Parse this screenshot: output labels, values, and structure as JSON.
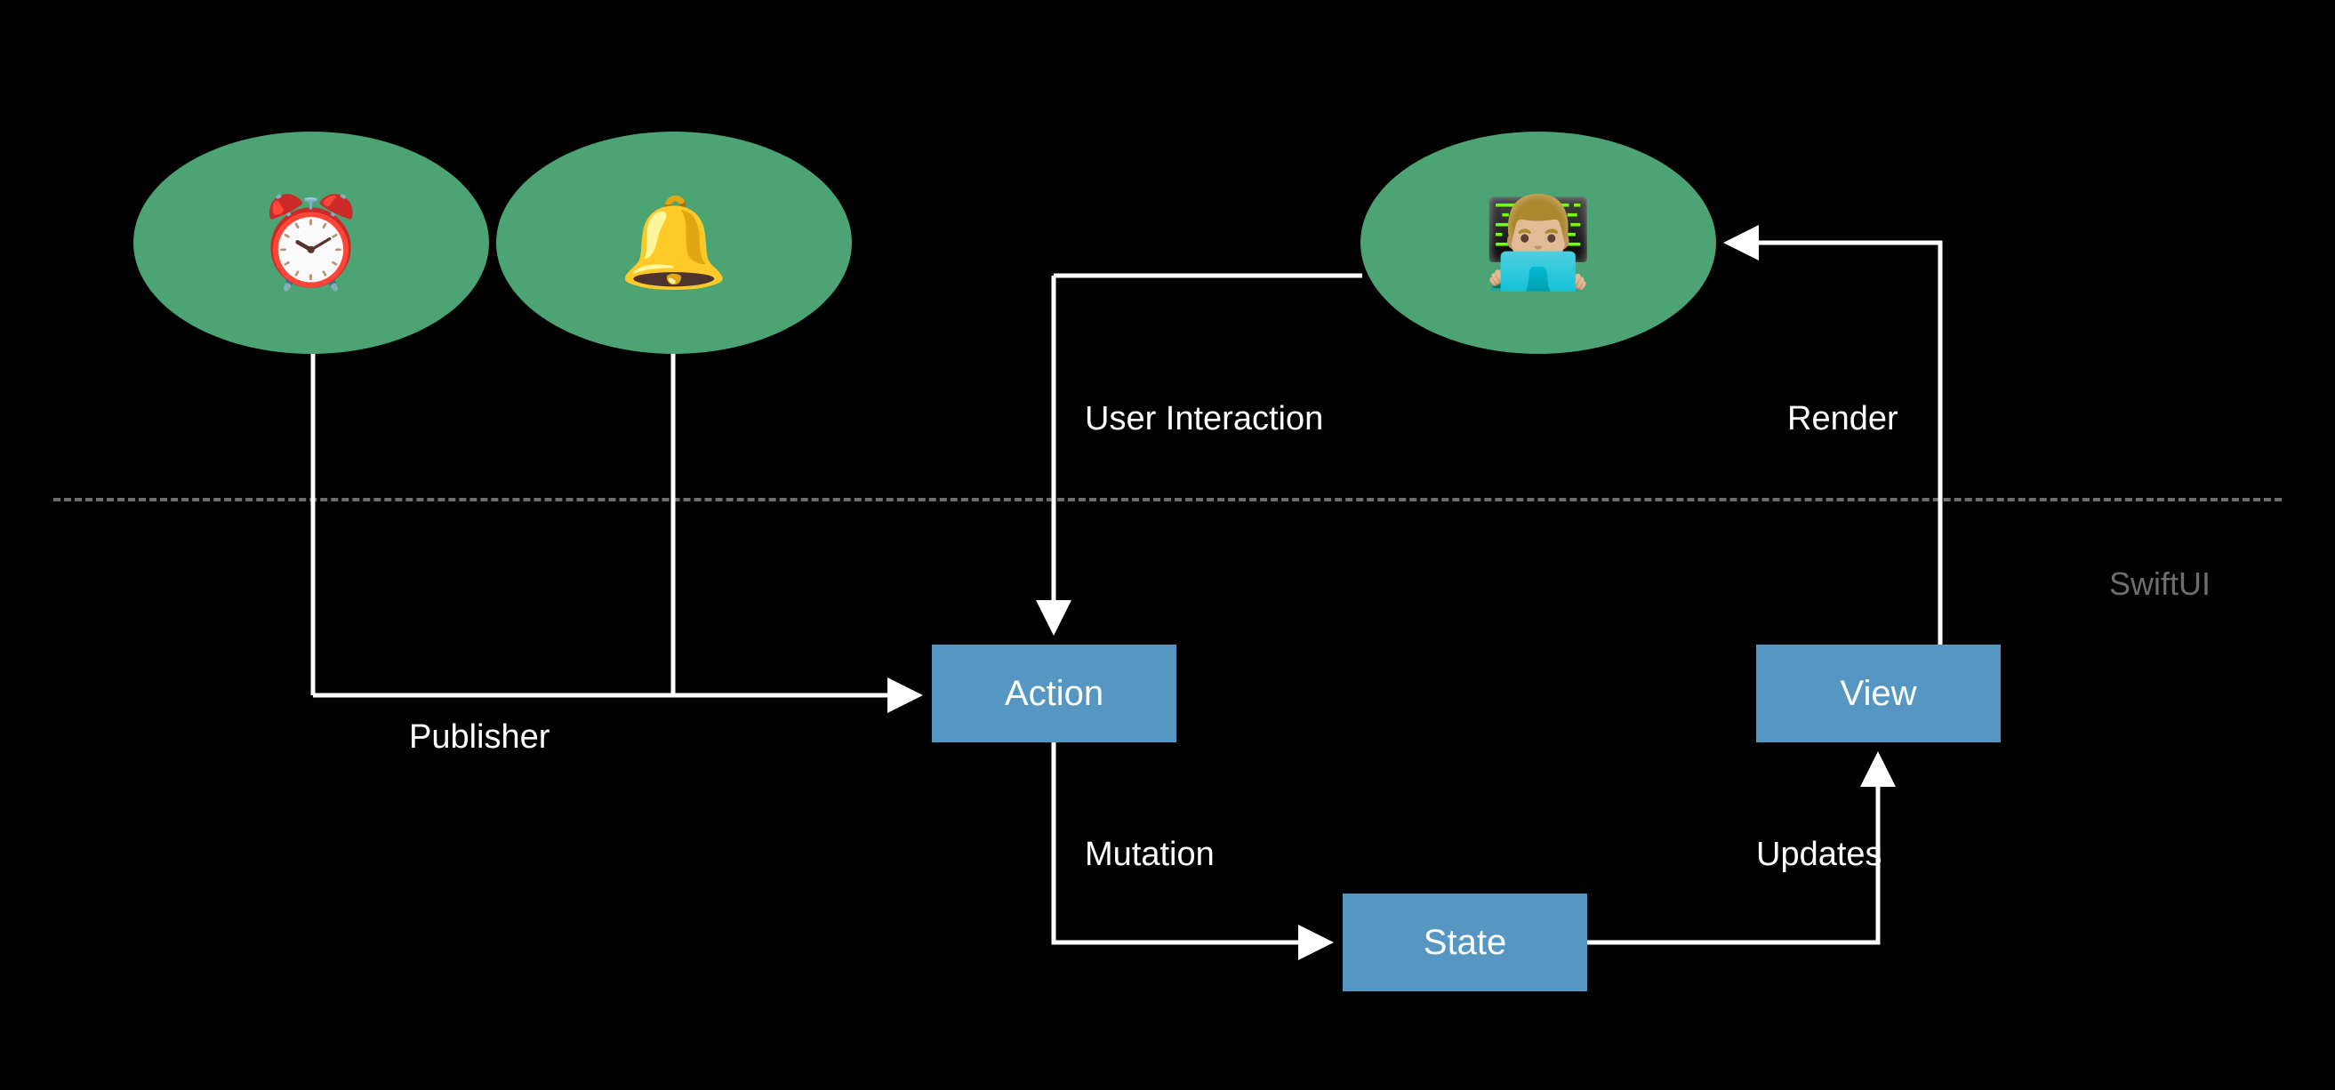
{
  "diagram": {
    "framework_label": "SwiftUI",
    "nodes": {
      "clock": {
        "icon": "⏰",
        "color": "#4ca373"
      },
      "bell": {
        "icon": "🔔",
        "color": "#4ca373"
      },
      "user": {
        "icon": "👨🏼‍💻",
        "color": "#4ca373"
      },
      "action": {
        "label": "Action",
        "color": "#5596c2"
      },
      "state": {
        "label": "State",
        "color": "#5596c2"
      },
      "view": {
        "label": "View",
        "color": "#5596c2"
      }
    },
    "edges": {
      "publisher": {
        "label": "Publisher"
      },
      "user_interaction": {
        "label": "User Interaction"
      },
      "mutation": {
        "label": "Mutation"
      },
      "updates": {
        "label": "Updates"
      },
      "render": {
        "label": "Render"
      }
    }
  }
}
